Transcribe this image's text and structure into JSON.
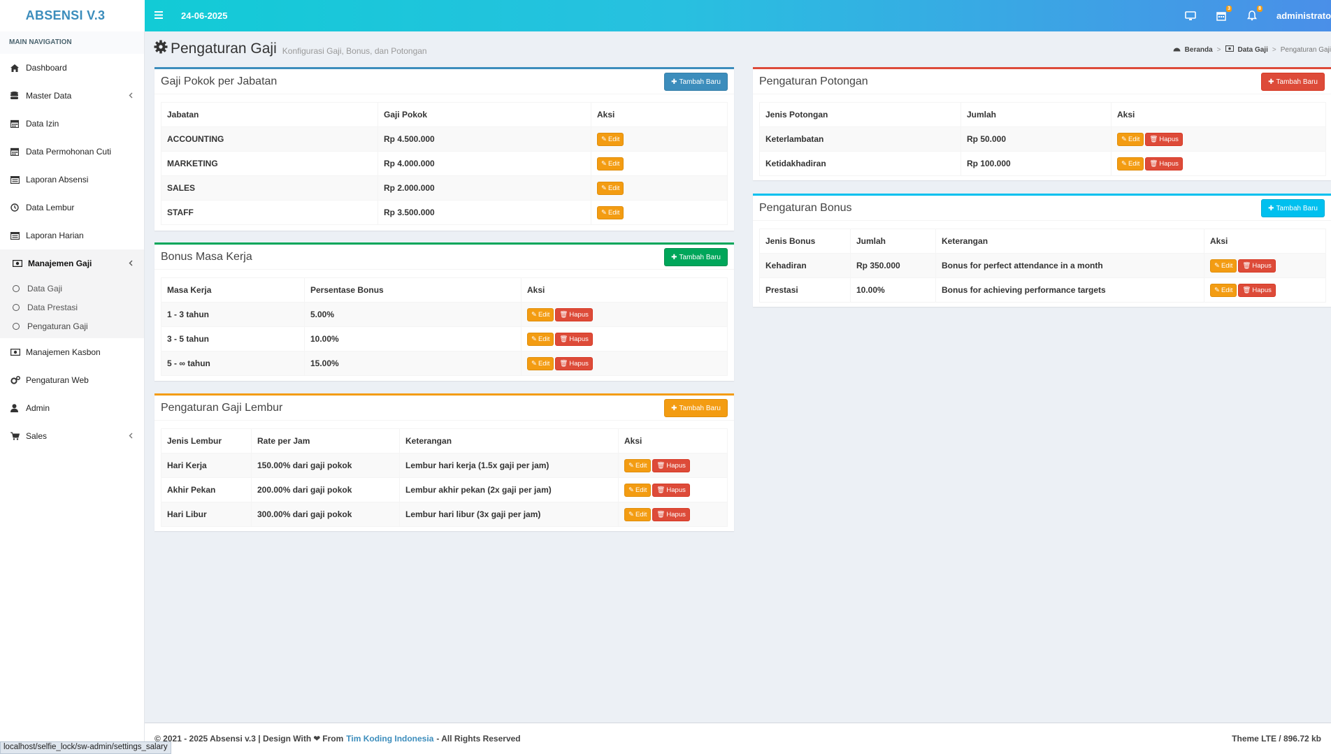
{
  "app": {
    "logo": "ABSENSI V.3",
    "date": "24-06-2025",
    "user": "administrator",
    "badges": {
      "calendar": "3",
      "bell": "8"
    }
  },
  "sidebar": {
    "header": "MAIN NAVIGATION",
    "items": [
      {
        "label": "Dashboard"
      },
      {
        "label": "Master Data"
      },
      {
        "label": "Data Izin"
      },
      {
        "label": "Data Permohonan Cuti"
      },
      {
        "label": "Laporan Absensi"
      },
      {
        "label": "Data Lembur"
      },
      {
        "label": "Laporan Harian"
      },
      {
        "label": "Manajemen Gaji"
      },
      {
        "label": "Manajemen Kasbon"
      },
      {
        "label": "Pengaturan Web"
      },
      {
        "label": "Admin"
      },
      {
        "label": "Sales"
      }
    ],
    "submenu": [
      {
        "label": "Data Gaji"
      },
      {
        "label": "Data Prestasi"
      },
      {
        "label": "Pengaturan Gaji"
      }
    ]
  },
  "page": {
    "title": "Pengaturan Gaji",
    "subtitle": "Konfigurasi Gaji, Bonus, dan Potongan",
    "breadcrumb": [
      "Beranda",
      "Data Gaji",
      "Pengaturan Gaji"
    ]
  },
  "buttons": {
    "new": "Tambah Baru",
    "edit": "Edit",
    "delete": "Hapus"
  },
  "gaji_pokok": {
    "title": "Gaji Pokok per Jabatan",
    "columns": [
      "Jabatan",
      "Gaji Pokok",
      "Aksi"
    ],
    "rows": [
      {
        "jabatan": "ACCOUNTING",
        "gaji": "Rp 4.500.000"
      },
      {
        "jabatan": "MARKETING",
        "gaji": "Rp 4.000.000"
      },
      {
        "jabatan": "SALES",
        "gaji": "Rp 2.000.000"
      },
      {
        "jabatan": "STAFF",
        "gaji": "Rp 3.500.000"
      }
    ]
  },
  "bonus_masa_kerja": {
    "title": "Bonus Masa Kerja",
    "columns": [
      "Masa Kerja",
      "Persentase Bonus",
      "Aksi"
    ],
    "rows": [
      {
        "masa": "1 - 3 tahun",
        "persen": "5.00%"
      },
      {
        "masa": "3 - 5 tahun",
        "persen": "10.00%"
      },
      {
        "masa": "5 - ∞ tahun",
        "persen": "15.00%"
      }
    ]
  },
  "gaji_lembur": {
    "title": "Pengaturan Gaji Lembur",
    "columns": [
      "Jenis Lembur",
      "Rate per Jam",
      "Keterangan",
      "Aksi"
    ],
    "rows": [
      {
        "jenis": "Hari Kerja",
        "rate": "150.00% dari gaji pokok",
        "ket": "Lembur hari kerja (1.5x gaji per jam)"
      },
      {
        "jenis": "Akhir Pekan",
        "rate": "200.00% dari gaji pokok",
        "ket": "Lembur akhir pekan (2x gaji per jam)"
      },
      {
        "jenis": "Hari Libur",
        "rate": "300.00% dari gaji pokok",
        "ket": "Lembur hari libur (3x gaji per jam)"
      }
    ]
  },
  "potongan": {
    "title": "Pengaturan Potongan",
    "columns": [
      "Jenis Potongan",
      "Jumlah",
      "Aksi"
    ],
    "rows": [
      {
        "jenis": "Keterlambatan",
        "jumlah": "Rp 50.000"
      },
      {
        "jenis": "Ketidakhadiran",
        "jumlah": "Rp 100.000"
      }
    ]
  },
  "bonus": {
    "title": "Pengaturan Bonus",
    "columns": [
      "Jenis Bonus",
      "Jumlah",
      "Keterangan",
      "Aksi"
    ],
    "rows": [
      {
        "jenis": "Kehadiran",
        "jumlah": "Rp 350.000",
        "ket": "Bonus for perfect attendance in a month"
      },
      {
        "jenis": "Prestasi",
        "jumlah": "10.00%",
        "ket": "Bonus for achieving performance targets"
      }
    ]
  },
  "footer": {
    "left_prefix": "© 2021 - 2025 Absensi v.3 | Design With",
    "left_from": "From",
    "link": "Tim Koding Indonesia",
    "left_suffix": "- All Rights Reserved",
    "right": "Theme LTE / 896.72 kb"
  },
  "status_url": "localhost/selfie_lock/sw-admin/settings_salary"
}
